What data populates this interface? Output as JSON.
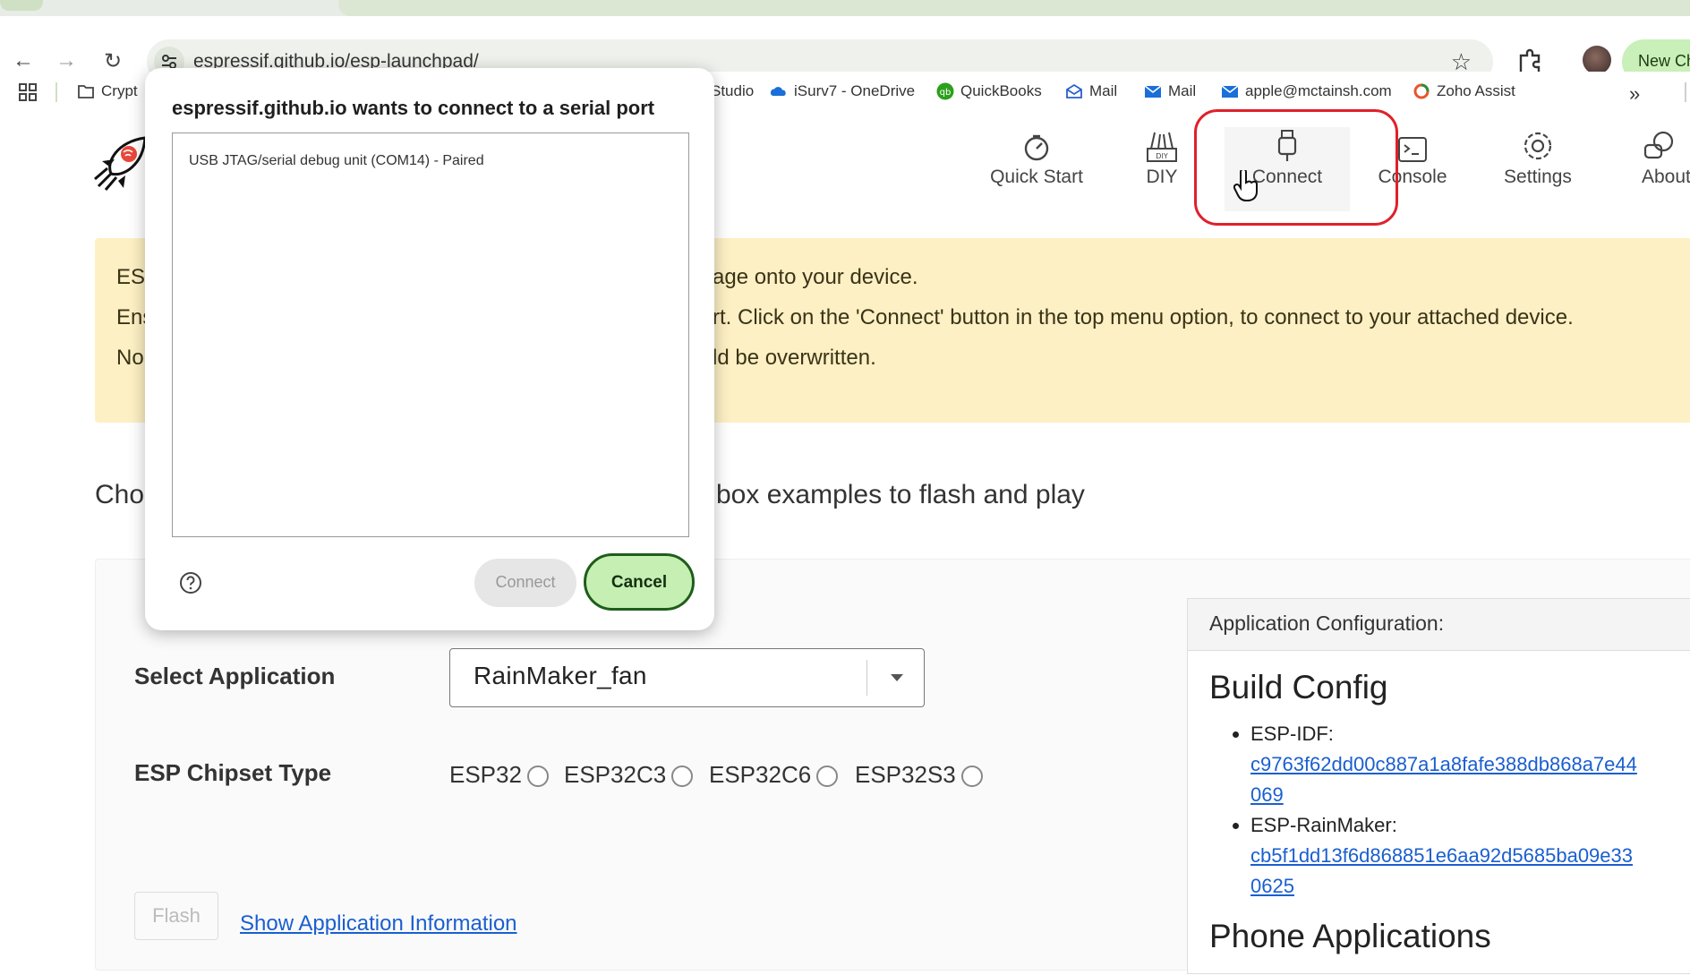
{
  "browser": {
    "url": "espressif.github.io/esp-launchpad/",
    "new_chrome_label": "New Ch",
    "bookmarks": [
      {
        "label": "Crypt",
        "icon": "folder-icon"
      },
      {
        "label": "Studio",
        "icon": "app-icon"
      },
      {
        "label": "iSurv7 - OneDrive",
        "icon": "onedrive-icon"
      },
      {
        "label": "QuickBooks",
        "icon": "quickbooks-icon"
      },
      {
        "label": "Mail",
        "icon": "mail-icon"
      },
      {
        "label": "Mail",
        "icon": "envelope-icon"
      },
      {
        "label": "apple@mctainsh.com",
        "icon": "envelope-icon"
      },
      {
        "label": "Zoho Assist",
        "icon": "zoho-icon"
      }
    ],
    "more_bookmarks": "»"
  },
  "nav": {
    "items": [
      {
        "label": "Quick Start",
        "icon": "speedometer-icon"
      },
      {
        "label": "DIY",
        "icon": "diy-icon"
      },
      {
        "label": "Connect",
        "icon": "usb-icon"
      },
      {
        "label": "Console",
        "icon": "terminal-icon"
      },
      {
        "label": "Settings",
        "icon": "gear-icon"
      },
      {
        "label": "About",
        "icon": "chat-icon"
      }
    ]
  },
  "notice": {
    "line1_left": "ESF",
    "line1_right": "age onto your device.",
    "line2_left": "Ens",
    "line2_right": "rt. Click on the 'Connect' button in the top menu option, to connect to your attached device.",
    "line3_left": "No",
    "line3_right": "ld be overwritten."
  },
  "choose": {
    "left": "Cho",
    "right": "box examples to flash and play"
  },
  "form": {
    "select_label": "Select Application",
    "select_value": "RainMaker_fan",
    "chipset_label": "ESP Chipset Type",
    "chipsets": [
      "ESP32",
      "ESP32C3",
      "ESP32C6",
      "ESP32S3"
    ],
    "flash_label": "Flash",
    "show_info_label": "Show Application Information"
  },
  "config": {
    "header": "Application Configuration:",
    "build_title": "Build Config",
    "idf_label": "ESP-IDF:",
    "idf_hash": "c9763f62dd00c887a1a8fafe388db868a7e44069",
    "rm_label": "ESP-RainMaker:",
    "rm_hash": "cb5f1dd13f6d868851e6aa92d5685ba09e330625",
    "phone_title": "Phone Applications"
  },
  "dialog": {
    "title": "espressif.github.io wants to connect to a serial port",
    "port": "USB JTAG/serial debug unit (COM14) - Paired",
    "connect_label": "Connect",
    "cancel_label": "Cancel"
  },
  "colors": {
    "highlight": "#e0202a",
    "notice_bg": "#fdf0c4",
    "link": "#1a5fd0",
    "cancel_bg": "#c6efb4"
  }
}
